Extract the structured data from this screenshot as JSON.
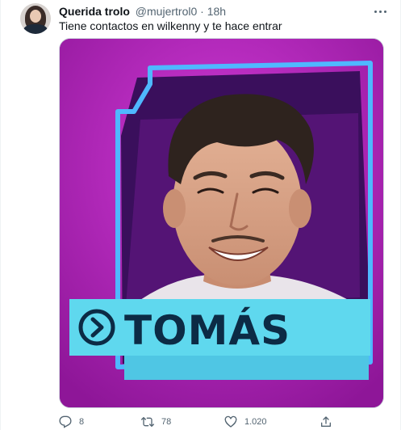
{
  "author": {
    "display_name": "Querida trolo",
    "handle": "@mujertrol0",
    "separator": "·",
    "timestamp": "18h"
  },
  "tweet": {
    "text": "Tiene contactos en wilkenny y te hace entrar"
  },
  "media": {
    "card_name": "TOMÁS",
    "colors": {
      "background": "#a51fae",
      "frame": "#4fb8ff",
      "name_bar": "#5fd8ee",
      "name_text": "#0c2b45"
    }
  },
  "actions": {
    "replies": "8",
    "retweets": "78",
    "likes": "1.020"
  },
  "icons": {
    "avatar": "profile-photo",
    "more": "more-horizontal-icon",
    "reply": "reply-icon",
    "retweet": "retweet-icon",
    "like": "heart-icon",
    "share": "share-icon"
  }
}
